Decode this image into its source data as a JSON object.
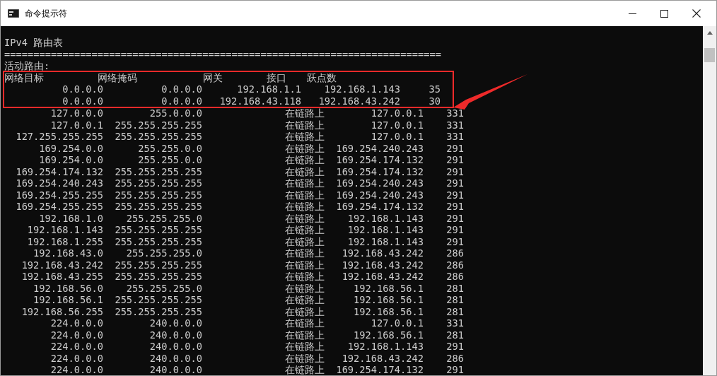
{
  "window": {
    "title": "命令提示符"
  },
  "console": {
    "heading": "IPv4 路由表",
    "separator": "===========================================================================",
    "section": "活动路由:"
  },
  "table": {
    "columns": [
      "网络目标",
      "网络掩码",
      "网关",
      "接口",
      "跃点数"
    ],
    "highlighted_rows": [
      {
        "kind": "gateway",
        "destination": "0.0.0.0",
        "netmask": "0.0.0.0",
        "gateway": "192.168.1.1",
        "interface": "192.168.1.143",
        "metric": "35"
      },
      {
        "kind": "gateway",
        "destination": "0.0.0.0",
        "netmask": "0.0.0.0",
        "gateway": "192.168.43.118",
        "interface": "192.168.43.242",
        "metric": "30"
      }
    ],
    "rows": [
      {
        "kind": "on_link",
        "destination": "127.0.0.0",
        "netmask": "255.0.0.0",
        "gateway": "在链路上",
        "interface": "127.0.0.1",
        "metric": "331"
      },
      {
        "kind": "on_link",
        "destination": "127.0.0.1",
        "netmask": "255.255.255.255",
        "gateway": "在链路上",
        "interface": "127.0.0.1",
        "metric": "331"
      },
      {
        "kind": "on_link",
        "destination": "127.255.255.255",
        "netmask": "255.255.255.255",
        "gateway": "在链路上",
        "interface": "127.0.0.1",
        "metric": "331"
      },
      {
        "kind": "on_link",
        "destination": "169.254.0.0",
        "netmask": "255.255.0.0",
        "gateway": "在链路上",
        "interface": "169.254.240.243",
        "metric": "291"
      },
      {
        "kind": "on_link",
        "destination": "169.254.0.0",
        "netmask": "255.255.0.0",
        "gateway": "在链路上",
        "interface": "169.254.174.132",
        "metric": "291"
      },
      {
        "kind": "on_link",
        "destination": "169.254.174.132",
        "netmask": "255.255.255.255",
        "gateway": "在链路上",
        "interface": "169.254.174.132",
        "metric": "291"
      },
      {
        "kind": "on_link",
        "destination": "169.254.240.243",
        "netmask": "255.255.255.255",
        "gateway": "在链路上",
        "interface": "169.254.240.243",
        "metric": "291"
      },
      {
        "kind": "on_link",
        "destination": "169.254.255.255",
        "netmask": "255.255.255.255",
        "gateway": "在链路上",
        "interface": "169.254.240.243",
        "metric": "291"
      },
      {
        "kind": "on_link",
        "destination": "169.254.255.255",
        "netmask": "255.255.255.255",
        "gateway": "在链路上",
        "interface": "169.254.174.132",
        "metric": "291"
      },
      {
        "kind": "on_link",
        "destination": "192.168.1.0",
        "netmask": "255.255.255.0",
        "gateway": "在链路上",
        "interface": "192.168.1.143",
        "metric": "291"
      },
      {
        "kind": "on_link",
        "destination": "192.168.1.143",
        "netmask": "255.255.255.255",
        "gateway": "在链路上",
        "interface": "192.168.1.143",
        "metric": "291"
      },
      {
        "kind": "on_link",
        "destination": "192.168.1.255",
        "netmask": "255.255.255.255",
        "gateway": "在链路上",
        "interface": "192.168.1.143",
        "metric": "291"
      },
      {
        "kind": "on_link",
        "destination": "192.168.43.0",
        "netmask": "255.255.255.0",
        "gateway": "在链路上",
        "interface": "192.168.43.242",
        "metric": "286"
      },
      {
        "kind": "on_link",
        "destination": "192.168.43.242",
        "netmask": "255.255.255.255",
        "gateway": "在链路上",
        "interface": "192.168.43.242",
        "metric": "286"
      },
      {
        "kind": "on_link",
        "destination": "192.168.43.255",
        "netmask": "255.255.255.255",
        "gateway": "在链路上",
        "interface": "192.168.43.242",
        "metric": "286"
      },
      {
        "kind": "on_link",
        "destination": "192.168.56.0",
        "netmask": "255.255.255.0",
        "gateway": "在链路上",
        "interface": "192.168.56.1",
        "metric": "281"
      },
      {
        "kind": "on_link",
        "destination": "192.168.56.1",
        "netmask": "255.255.255.255",
        "gateway": "在链路上",
        "interface": "192.168.56.1",
        "metric": "281"
      },
      {
        "kind": "on_link",
        "destination": "192.168.56.255",
        "netmask": "255.255.255.255",
        "gateway": "在链路上",
        "interface": "192.168.56.1",
        "metric": "281"
      },
      {
        "kind": "on_link",
        "destination": "224.0.0.0",
        "netmask": "240.0.0.0",
        "gateway": "在链路上",
        "interface": "127.0.0.1",
        "metric": "331"
      },
      {
        "kind": "on_link",
        "destination": "224.0.0.0",
        "netmask": "240.0.0.0",
        "gateway": "在链路上",
        "interface": "192.168.56.1",
        "metric": "281"
      },
      {
        "kind": "on_link",
        "destination": "224.0.0.0",
        "netmask": "240.0.0.0",
        "gateway": "在链路上",
        "interface": "192.168.1.143",
        "metric": "291"
      },
      {
        "kind": "on_link",
        "destination": "224.0.0.0",
        "netmask": "240.0.0.0",
        "gateway": "在链路上",
        "interface": "192.168.43.242",
        "metric": "286"
      },
      {
        "kind": "on_link",
        "destination": "224.0.0.0",
        "netmask": "240.0.0.0",
        "gateway": "在链路上",
        "interface": "169.254.174.132",
        "metric": "291"
      }
    ]
  }
}
